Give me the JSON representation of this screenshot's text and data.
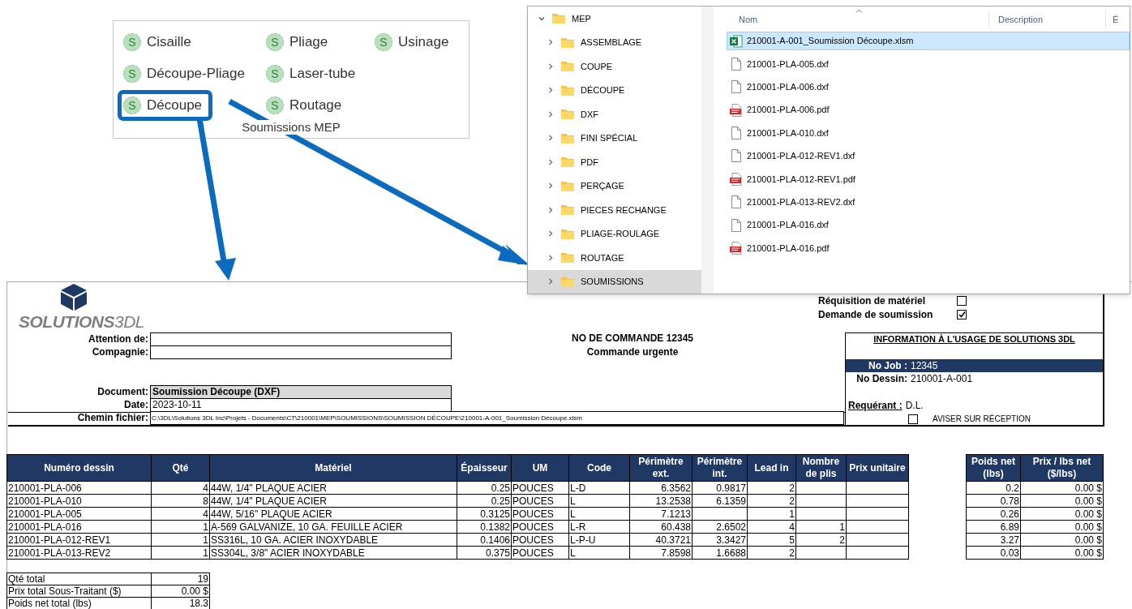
{
  "ribbon_group": {
    "label": "Soumissions MEP",
    "buttons": [
      {
        "label": "Cisaille",
        "icon": "S",
        "highlighted": false
      },
      {
        "label": "Découpe-Pliage",
        "icon": "S",
        "highlighted": false
      },
      {
        "label": "Découpe",
        "icon": "S",
        "highlighted": true
      },
      {
        "label": "Pliage",
        "icon": "S",
        "highlighted": false
      },
      {
        "label": "Laser-tube",
        "icon": "S",
        "highlighted": false
      },
      {
        "label": "Routage",
        "icon": "S",
        "highlighted": false
      },
      {
        "label": "Usinage",
        "icon": "S",
        "highlighted": false
      }
    ]
  },
  "explorer": {
    "tree": [
      {
        "label": "MEP",
        "expanded": true,
        "selected": false,
        "children": [
          {
            "label": "ASSEMBLAGE",
            "expanded": false,
            "selected": false
          },
          {
            "label": "COUPE",
            "expanded": false,
            "selected": false
          },
          {
            "label": "DÉCOUPE",
            "expanded": false,
            "selected": false
          },
          {
            "label": "DXF",
            "expanded": false,
            "selected": false
          },
          {
            "label": "FINI SPÉCIAL",
            "expanded": false,
            "selected": false
          },
          {
            "label": "PDF",
            "expanded": false,
            "selected": false
          },
          {
            "label": "PERÇAGE",
            "expanded": false,
            "selected": false
          },
          {
            "label": "PIECES RECHANGE",
            "expanded": false,
            "selected": false
          },
          {
            "label": "PLIAGE-ROULAGE",
            "expanded": false,
            "selected": false
          },
          {
            "label": "ROUTAGE",
            "expanded": false,
            "selected": false
          },
          {
            "label": "SOUMISSIONS",
            "expanded": false,
            "selected": true
          }
        ]
      }
    ],
    "columns": [
      "Nom",
      "Description",
      "É"
    ],
    "files": [
      {
        "name": "210001-A-001_Soumission Découpe.xlsm",
        "kind": "excel",
        "selected": true
      },
      {
        "name": "210001-PLA-005.dxf",
        "kind": "file",
        "selected": false
      },
      {
        "name": "210001-PLA-006.dxf",
        "kind": "file",
        "selected": false
      },
      {
        "name": "210001-PLA-006.pdf",
        "kind": "pdf",
        "selected": false
      },
      {
        "name": "210001-PLA-010.dxf",
        "kind": "file",
        "selected": false
      },
      {
        "name": "210001-PLA-012-REV1.dxf",
        "kind": "file",
        "selected": false
      },
      {
        "name": "210001-PLA-012-REV1.pdf",
        "kind": "pdf",
        "selected": false
      },
      {
        "name": "210001-PLA-013-REV2.dxf",
        "kind": "file",
        "selected": false
      },
      {
        "name": "210001-PLA-016.dxf",
        "kind": "file",
        "selected": false
      },
      {
        "name": "210001-PLA-016.pdf",
        "kind": "pdf",
        "selected": false
      }
    ]
  },
  "sheet": {
    "logo": "**SOLUTIONS**3DL",
    "contact_fields": [
      {
        "label": "Attention de:"
      },
      {
        "label": "Compagnie:"
      }
    ],
    "document_fields": [
      {
        "label": "Document:",
        "value": "Soumission Découpe (DXF)",
        "kind": "title"
      },
      {
        "label": "Date:",
        "value": "2023-10-11",
        "kind": "plain"
      },
      {
        "label": "Chemin fichier:",
        "value": "C:\\3DL\\Solutions 3DL Inc\\Projets - Documents\\CT\\210001\\MEP\\SOUMISSIONS\\SOUMISSION DÉCOUPE\\210001-A-001_Soumission Découpe.xlsm",
        "kind": "path"
      }
    ],
    "order": {
      "number": "NO DE COMMANDE 12345",
      "urgency": "Commande urgente"
    },
    "options": [
      {
        "label": "Réquisition de matériel",
        "checked": false
      },
      {
        "label": "Demande de soumission",
        "checked": true
      }
    ],
    "info_box": {
      "title": "INFORMATION À L'USAGE DE SOLUTIONS 3DL",
      "job": {
        "label": "No Job :",
        "value": "12345"
      },
      "drawing": {
        "label": "No Dessin:",
        "value": "210001-A-001"
      },
      "requester": {
        "label": "Requérant :",
        "value": "D.L."
      },
      "notify": {
        "label": "AVISER SUR RÉCEPTION",
        "checked": false
      }
    },
    "table": {
      "columns": [
        "Numéro dessin",
        "Qté",
        "Matériel",
        "Épaisseur",
        "UM",
        "Code",
        "Périmètre ext.",
        "Périmètre int.",
        "Lead in",
        "Nombre de plis",
        "Prix unitaire"
      ],
      "rows": [
        [
          "210001-PLA-006",
          "4",
          "44W, 1/4\" PLAQUE ACIER",
          "0.25",
          "POUCES",
          "L-D",
          "6.3562",
          "0.9817",
          "2",
          null,
          null
        ],
        [
          "210001-PLA-010",
          "8",
          "44W, 1/4\" PLAQUE ACIER",
          "0.25",
          "POUCES",
          "L",
          "13.2538",
          "6.1359",
          "2",
          null,
          null
        ],
        [
          "210001-PLA-005",
          "4",
          "44W, 5/16\" PLAQUE ACIER",
          "0.3125",
          "POUCES",
          "L",
          "7.1213",
          null,
          "1",
          null,
          null
        ],
        [
          "210001-PLA-016",
          "1",
          "A-569 GALVANIZE, 10 GA. FEUILLE ACIER",
          "0.1382",
          "POUCES",
          "L-R",
          "60.438",
          "2.6502",
          "4",
          "1",
          null
        ],
        [
          "210001-PLA-012-REV1",
          "1",
          "SS316L, 10 GA. ACIER INOXYDABLE",
          "0.1406",
          "POUCES",
          "L-P-U",
          "40.3721",
          "3.3427",
          "5",
          "2",
          null
        ],
        [
          "210001-PLA-013-REV2",
          "1",
          "SS304L, 3/8\" ACIER INOXYDABLE",
          "0.375",
          "POUCES",
          "L",
          "7.8598",
          "1.6688",
          "2",
          null,
          null
        ]
      ]
    },
    "weight_table": {
      "columns": [
        "Poids net (lbs)",
        "Prix / lbs net ($/lbs)"
      ],
      "rows": [
        [
          "0.2",
          "0.00 $"
        ],
        [
          "0.78",
          "0.00 $"
        ],
        [
          "0.26",
          "0.00 $"
        ],
        [
          "6.89",
          "0.00 $"
        ],
        [
          "3.27",
          "0.00 $"
        ],
        [
          "0.03",
          "0.00 $"
        ]
      ]
    },
    "totals": [
      {
        "label": "Qté total",
        "value": "19"
      },
      {
        "label": "Prix total Sous-Traitant ($)",
        "value": "0.00 $"
      },
      {
        "label": "Poids net total (lbs)",
        "value": "18.3"
      }
    ]
  }
}
